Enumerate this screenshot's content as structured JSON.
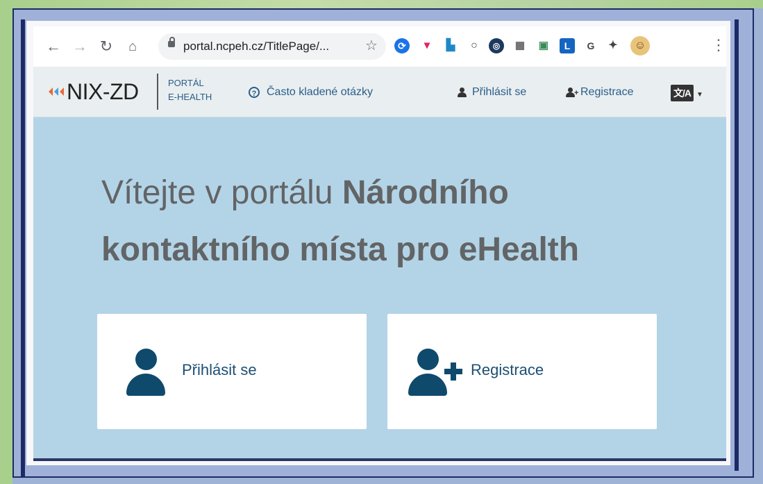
{
  "browser": {
    "url": "portal.ncpeh.cz/TitlePage/...",
    "extension_icons": [
      "swirl-icon",
      "pocket-icon",
      "chart-icon",
      "circle-icon",
      "target-icon",
      "grid-icon",
      "photo-icon",
      "l-icon",
      "g-icon",
      "puzzle-icon",
      "avatar-icon"
    ],
    "ext_letters": {
      "l": "L",
      "g": "G"
    }
  },
  "header": {
    "logo": "NIX-ZD",
    "portal_line1": "PORTÁL",
    "portal_line2": "E-HEALTH",
    "faq": "Často kladené otázky",
    "login": "Přihlásit se",
    "register": "Registrace",
    "language": "文/A"
  },
  "hero": {
    "line1_normal": "Vítejte v portálu ",
    "line1_bold": "Národního",
    "line2": "kontaktního místa pro eHealth"
  },
  "cards": {
    "login_label": "Přihlásit se",
    "register_label": "Registrace"
  },
  "colors": {
    "accent": "#0f4a6c",
    "link": "#2a5d8a",
    "hero_bg": "#b3d4e7"
  }
}
